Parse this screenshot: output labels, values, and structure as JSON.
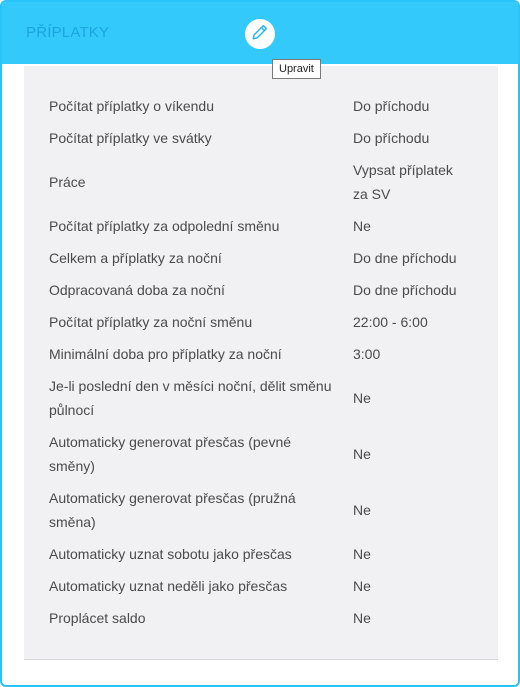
{
  "header": {
    "title": "PŘÍPLATKY",
    "edit_tooltip": "Upravit"
  },
  "settings": [
    {
      "label": "Počítat příplatky o víkendu",
      "value": "Do příchodu"
    },
    {
      "label": "Počítat příplatky ve svátky",
      "value": "Do příchodu"
    },
    {
      "label": "Práce",
      "value": "Vypsat příplatek za SV"
    },
    {
      "label": "Počítat příplatky za odpolední směnu",
      "value": "Ne"
    },
    {
      "label": "Celkem a příplatky za noční",
      "value": "Do dne příchodu"
    },
    {
      "label": "Odpracovaná doba za noční",
      "value": "Do dne příchodu"
    },
    {
      "label": "Počítat příplatky za noční směnu",
      "value": "22:00 - 6:00"
    },
    {
      "label": "Minimální doba pro příplatky za noční",
      "value": "3:00"
    },
    {
      "label": "Je-li poslední den v měsíci noční, dělit směnu půlnocí",
      "value": "Ne"
    },
    {
      "label": "Automaticky generovat přesčas (pevné směny)",
      "value": "Ne"
    },
    {
      "label": "Automaticky generovat přesčas (pružná směna)",
      "value": "Ne"
    },
    {
      "label": "Automaticky uznat sobotu jako přesčas",
      "value": "Ne"
    },
    {
      "label": "Automaticky uznat neděli jako přesčas",
      "value": "Ne"
    },
    {
      "label": "Proplácet saldo",
      "value": "Ne"
    }
  ]
}
